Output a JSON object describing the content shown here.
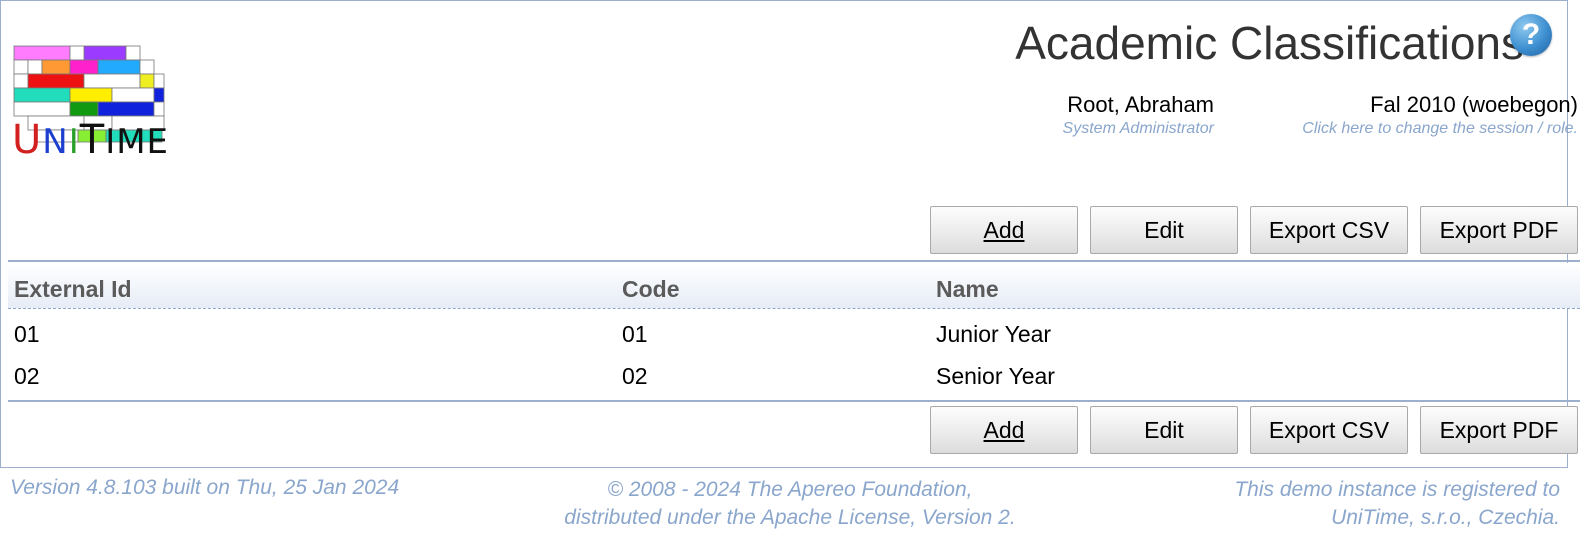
{
  "header": {
    "page_title": "Academic Classifications",
    "help_icon": "question-circle-icon",
    "user_name": "Root, Abraham",
    "user_role": "System Administrator",
    "session_name": "Fal 2010 (woebegon)",
    "session_hint": "Click here to change the session / role."
  },
  "logo": {
    "brand": "UniTime"
  },
  "toolbar": {
    "add_label": "Add",
    "edit_label": "Edit",
    "export_csv_label": "Export CSV",
    "export_pdf_label": "Export PDF"
  },
  "table": {
    "columns": [
      "External Id",
      "Code",
      "Name"
    ],
    "rows": [
      {
        "external_id": "01",
        "code": "01",
        "name": "Junior Year"
      },
      {
        "external_id": "02",
        "code": "02",
        "name": "Senior Year"
      }
    ]
  },
  "footer": {
    "version": "Version 4.8.103 built on Thu, 25 Jan 2024",
    "copyright_line1": "© 2008 - 2024 The Apereo Foundation,",
    "copyright_line2": "distributed under the Apache License, Version 2.",
    "registration_line1": "This demo instance is registered to",
    "registration_line2": "UniTime, s.r.o., Czechia."
  },
  "colors": {
    "accent_border": "#9cb0ce",
    "muted_text": "#8aa6cc",
    "header_text": "#5b5b5b"
  }
}
